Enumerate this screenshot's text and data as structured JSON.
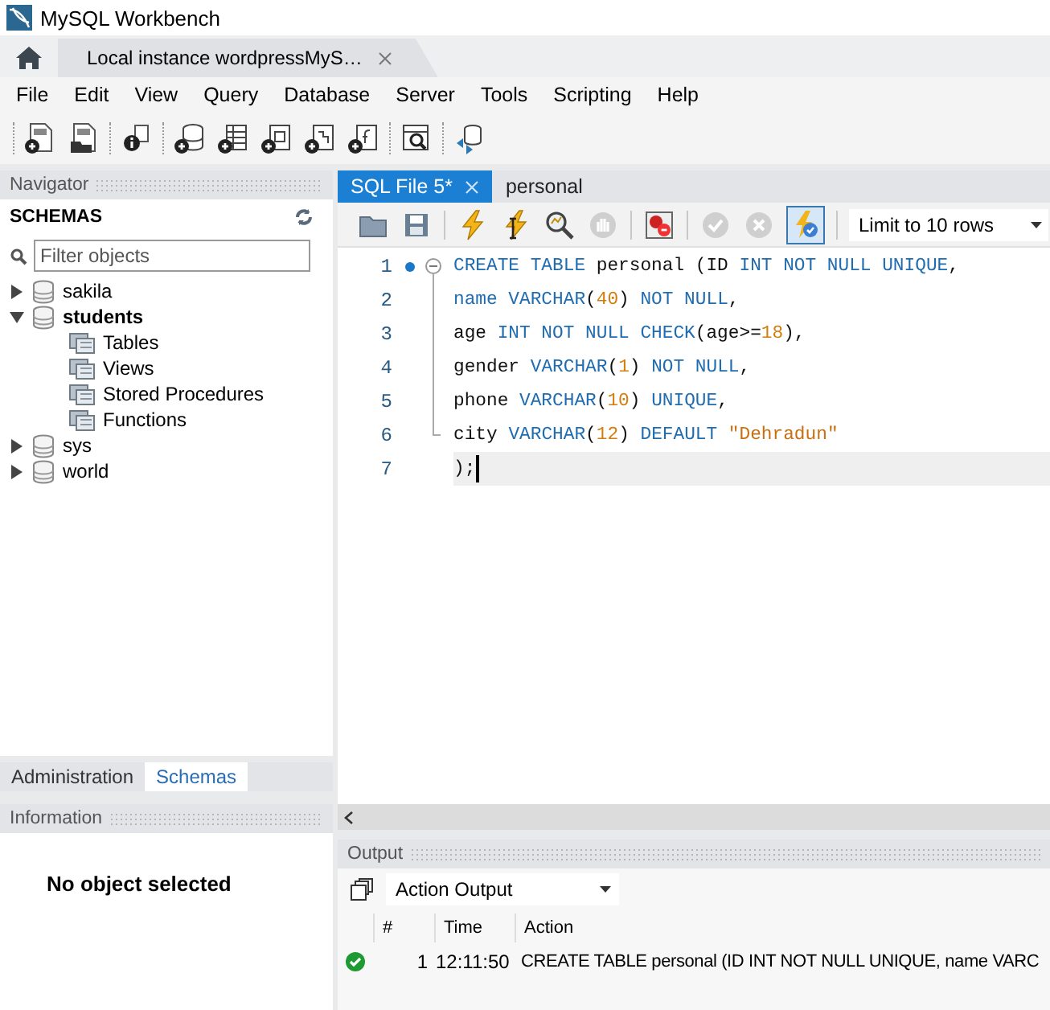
{
  "window": {
    "title": "MySQL Workbench"
  },
  "connection_tabs": [
    {
      "label": "Local instance wordpressMyS…",
      "selected": true
    }
  ],
  "menu": [
    "File",
    "Edit",
    "View",
    "Query",
    "Database",
    "Server",
    "Tools",
    "Scripting",
    "Help"
  ],
  "toolbar_groups": [
    {
      "items": [
        {
          "kind": "new-sql"
        },
        {
          "kind": "open-sql"
        }
      ]
    },
    {
      "items": [
        {
          "kind": "info"
        }
      ]
    },
    {
      "items": [
        {
          "kind": "new-schema"
        },
        {
          "kind": "new-table"
        },
        {
          "kind": "new-view"
        },
        {
          "kind": "new-procedure"
        },
        {
          "kind": "new-function"
        }
      ]
    },
    {
      "items": [
        {
          "kind": "inspect"
        }
      ]
    },
    {
      "items": [
        {
          "kind": "reconnect"
        }
      ]
    }
  ],
  "navigator": {
    "title": "Navigator",
    "section": "SCHEMAS",
    "filter_placeholder": "Filter objects",
    "schemas": [
      {
        "label": "sakila",
        "expanded": false,
        "default": false
      },
      {
        "label": "students",
        "expanded": true,
        "default": true,
        "children": [
          {
            "label": "Tables"
          },
          {
            "label": "Views"
          },
          {
            "label": "Stored Procedures"
          },
          {
            "label": "Functions"
          }
        ]
      },
      {
        "label": "sys",
        "expanded": false,
        "default": false
      },
      {
        "label": "world",
        "expanded": false,
        "default": false
      }
    ]
  },
  "sidebar_tabs": [
    {
      "label": "Administration",
      "selected": false
    },
    {
      "label": "Schemas",
      "selected": true
    }
  ],
  "information": {
    "title": "Information",
    "message": "No object selected"
  },
  "editor_tabs": [
    {
      "label": "SQL File 5*",
      "selected": true
    },
    {
      "label": "personal",
      "selected": false
    }
  ],
  "editor_toolbar": [
    {
      "kind": "open"
    },
    {
      "kind": "save"
    },
    {
      "kind": "execute"
    },
    {
      "kind": "execute-current"
    },
    {
      "kind": "explain"
    },
    {
      "kind": "stop",
      "disabled": true
    },
    {
      "kind": "stop-on-error"
    },
    {
      "kind": "commit",
      "disabled": true
    },
    {
      "kind": "rollback",
      "disabled": true
    },
    {
      "kind": "autocommit",
      "on": true
    }
  ],
  "limit": {
    "value": "Limit to 10 rows"
  },
  "code_lines": [
    {
      "number": "1",
      "statement_start": true,
      "kind": "fold-start",
      "current": false,
      "tokens": [
        {
          "kind": "keyword",
          "text": "CREATE TABLE"
        },
        {
          "kind": "plain",
          "text": " personal (ID "
        },
        {
          "kind": "keyword",
          "text": "INT NOT NULL UNIQUE"
        },
        {
          "kind": "plain",
          "text": ","
        }
      ]
    },
    {
      "number": "2",
      "statement_start": false,
      "kind": "fold-middle",
      "current": false,
      "tokens": [
        {
          "kind": "keyword",
          "text": "name VARCHAR"
        },
        {
          "kind": "plain",
          "text": "("
        },
        {
          "kind": "number",
          "text": "40"
        },
        {
          "kind": "plain",
          "text": ") "
        },
        {
          "kind": "keyword",
          "text": "NOT NULL"
        },
        {
          "kind": "plain",
          "text": ","
        }
      ]
    },
    {
      "number": "3",
      "statement_start": false,
      "kind": "fold-middle",
      "current": false,
      "tokens": [
        {
          "kind": "plain",
          "text": "age "
        },
        {
          "kind": "keyword",
          "text": "INT NOT NULL CHECK"
        },
        {
          "kind": "plain",
          "text": "(age>="
        },
        {
          "kind": "number",
          "text": "18"
        },
        {
          "kind": "plain",
          "text": "),"
        }
      ]
    },
    {
      "number": "4",
      "statement_start": false,
      "kind": "fold-middle",
      "current": false,
      "tokens": [
        {
          "kind": "plain",
          "text": "gender "
        },
        {
          "kind": "keyword",
          "text": "VARCHAR"
        },
        {
          "kind": "plain",
          "text": "("
        },
        {
          "kind": "number",
          "text": "1"
        },
        {
          "kind": "plain",
          "text": ") "
        },
        {
          "kind": "keyword",
          "text": "NOT NULL"
        },
        {
          "kind": "plain",
          "text": ","
        }
      ]
    },
    {
      "number": "5",
      "statement_start": false,
      "kind": "fold-middle",
      "current": false,
      "tokens": [
        {
          "kind": "plain",
          "text": "phone "
        },
        {
          "kind": "keyword",
          "text": "VARCHAR"
        },
        {
          "kind": "plain",
          "text": "("
        },
        {
          "kind": "number",
          "text": "10"
        },
        {
          "kind": "plain",
          "text": ") "
        },
        {
          "kind": "keyword",
          "text": "UNIQUE"
        },
        {
          "kind": "plain",
          "text": ","
        }
      ]
    },
    {
      "number": "6",
      "statement_start": false,
      "kind": "fold-end",
      "current": false,
      "tokens": [
        {
          "kind": "plain",
          "text": "city "
        },
        {
          "kind": "keyword",
          "text": "VARCHAR"
        },
        {
          "kind": "plain",
          "text": "("
        },
        {
          "kind": "number",
          "text": "12"
        },
        {
          "kind": "plain",
          "text": ") "
        },
        {
          "kind": "keyword",
          "text": "DEFAULT "
        },
        {
          "kind": "string",
          "text": "\"Dehradun\""
        }
      ]
    },
    {
      "number": "7",
      "statement_start": false,
      "kind": "plain",
      "current": true,
      "tokens": [
        {
          "kind": "plain",
          "text": ");"
        }
      ]
    }
  ],
  "output": {
    "title": "Output",
    "mode": "Action Output",
    "columns": [
      "#",
      "Time",
      "Action"
    ],
    "rows": [
      {
        "kind": "success",
        "number": "1",
        "time": "12:11:50",
        "action": "CREATE TABLE personal (ID INT NOT NULL UNIQUE, name VARC"
      }
    ]
  }
}
